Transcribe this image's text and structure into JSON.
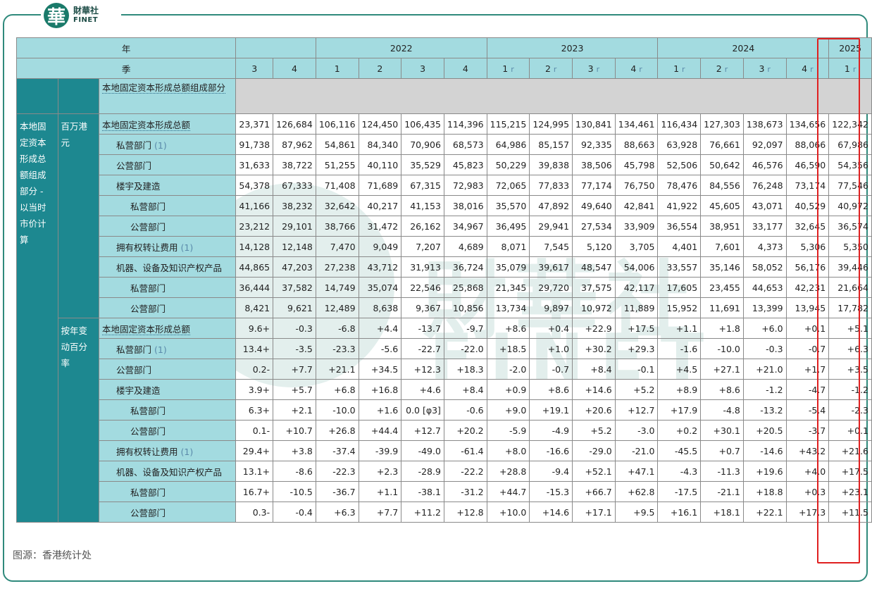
{
  "logo": {
    "cn": "財華社",
    "en": "FINET",
    "mark": "華"
  },
  "watermark": {
    "cn": "財華社",
    "en": "FINET"
  },
  "header": {
    "year_label": "年",
    "quarter_label": "季",
    "years": [
      "2022",
      "2023",
      "2024",
      "2025"
    ],
    "quarters": [
      "3",
      "4",
      "1",
      "2",
      "3",
      "4",
      "1",
      "2",
      "3",
      "4",
      "1",
      "2",
      "3",
      "4",
      "1"
    ],
    "r_flags": [
      false,
      false,
      false,
      false,
      false,
      false,
      true,
      true,
      true,
      true,
      true,
      true,
      true,
      true,
      true
    ],
    "r_symbol": "r"
  },
  "section_label": "本地固定资本形成总额组成部分",
  "left_group": "本地固定资本形成总额组成部分 - 以当时市价计算",
  "unit_groups": [
    "百万港元",
    "按年变动百分率"
  ],
  "rows_a": [
    {
      "label": "本地固定资本形成总额",
      "note": "",
      "level": 1,
      "values": [
        "23,371",
        "126,684",
        "106,116",
        "124,450",
        "106,435",
        "114,396",
        "115,215",
        "124,995",
        "130,841",
        "134,461",
        "116,434",
        "127,303",
        "138,673",
        "134,656",
        "122,342"
      ]
    },
    {
      "label": "私营部门",
      "note": "(1)",
      "level": 2,
      "values": [
        "91,738",
        "87,962",
        "54,861",
        "84,340",
        "70,906",
        "68,573",
        "64,986",
        "85,157",
        "92,335",
        "88,663",
        "63,928",
        "76,661",
        "92,097",
        "88,066",
        "67,986"
      ]
    },
    {
      "label": "公营部门",
      "note": "",
      "level": 2,
      "values": [
        "31,633",
        "38,722",
        "51,255",
        "40,110",
        "35,529",
        "45,823",
        "50,229",
        "39,838",
        "38,506",
        "45,798",
        "52,506",
        "50,642",
        "46,576",
        "46,590",
        "54,356"
      ]
    },
    {
      "label": "楼宇及建造",
      "note": "",
      "level": 2,
      "values": [
        "54,378",
        "67,333",
        "71,408",
        "71,689",
        "67,315",
        "72,983",
        "72,065",
        "77,833",
        "77,174",
        "76,750",
        "78,476",
        "84,556",
        "76,248",
        "73,174",
        "77,546"
      ]
    },
    {
      "label": "私营部门",
      "note": "",
      "level": 3,
      "values": [
        "41,166",
        "38,232",
        "32,642",
        "40,217",
        "41,153",
        "38,016",
        "35,570",
        "47,892",
        "49,640",
        "42,841",
        "41,922",
        "45,605",
        "43,071",
        "40,529",
        "40,972"
      ]
    },
    {
      "label": "公营部门",
      "note": "",
      "level": 3,
      "values": [
        "23,212",
        "29,101",
        "38,766",
        "31,472",
        "26,162",
        "34,967",
        "36,495",
        "29,941",
        "27,534",
        "33,909",
        "36,554",
        "38,951",
        "33,177",
        "32,645",
        "36,574"
      ]
    },
    {
      "label": "拥有权转让费用",
      "note": "(1)",
      "level": 2,
      "values": [
        "14,128",
        "12,148",
        "7,470",
        "9,049",
        "7,207",
        "4,689",
        "8,071",
        "7,545",
        "5,120",
        "3,705",
        "4,401",
        "7,601",
        "4,373",
        "5,306",
        "5,350"
      ]
    },
    {
      "label": "机器、设备及知识产权产品",
      "note": "",
      "level": 2,
      "values": [
        "44,865",
        "47,203",
        "27,238",
        "43,712",
        "31,913",
        "36,724",
        "35,079",
        "39,617",
        "48,547",
        "54,006",
        "33,557",
        "35,146",
        "58,052",
        "56,176",
        "39,446"
      ]
    },
    {
      "label": "私营部门",
      "note": "",
      "level": 3,
      "values": [
        "36,444",
        "37,582",
        "14,749",
        "35,074",
        "22,546",
        "25,868",
        "21,345",
        "29,720",
        "37,575",
        "42,117",
        "17,605",
        "23,455",
        "44,653",
        "42,231",
        "21,664"
      ]
    },
    {
      "label": "公营部门",
      "note": "",
      "level": 3,
      "values": [
        "8,421",
        "9,621",
        "12,489",
        "8,638",
        "9,367",
        "10,856",
        "13,734",
        "9,897",
        "10,972",
        "11,889",
        "15,952",
        "11,691",
        "13,399",
        "13,945",
        "17,782"
      ]
    }
  ],
  "rows_b": [
    {
      "label": "本地固定资本形成总额",
      "note": "",
      "level": 1,
      "values": [
        "+9.6",
        "-0.3",
        "-6.8",
        "+4.4",
        "-13.7",
        "-9.7",
        "+8.6",
        "+0.4",
        "+22.9",
        "+17.5",
        "+1.1",
        "+1.8",
        "+6.0",
        "+0.1",
        "+5.1"
      ]
    },
    {
      "label": "私营部门",
      "note": "(1)",
      "level": 2,
      "values": [
        "+13.4",
        "-3.5",
        "-23.3",
        "-5.6",
        "-22.7",
        "-22.0",
        "+18.5",
        "+1.0",
        "+30.2",
        "+29.3",
        "-1.6",
        "-10.0",
        "-0.3",
        "-0.7",
        "+6.3"
      ]
    },
    {
      "label": "公营部门",
      "note": "",
      "level": 2,
      "values": [
        "-0.2",
        "+7.7",
        "+21.1",
        "+34.5",
        "+12.3",
        "+18.3",
        "-2.0",
        "-0.7",
        "+8.4",
        "-0.1",
        "+4.5",
        "+27.1",
        "+21.0",
        "+1.7",
        "+3.5"
      ]
    },
    {
      "label": "楼宇及建造",
      "note": "",
      "level": 2,
      "values": [
        "+3.9",
        "+5.7",
        "+6.8",
        "+16.8",
        "+4.6",
        "+8.4",
        "+0.9",
        "+8.6",
        "+14.6",
        "+5.2",
        "+8.9",
        "+8.6",
        "-1.2",
        "-4.7",
        "-1.2"
      ]
    },
    {
      "label": "私营部门",
      "note": "",
      "level": 3,
      "values": [
        "+6.3",
        "+2.1",
        "-10.0",
        "+1.6",
        "0.0 [φ3]",
        "-0.6",
        "+9.0",
        "+19.1",
        "+20.6",
        "+12.7",
        "+17.9",
        "-4.8",
        "-13.2",
        "-5.4",
        "-2.3"
      ]
    },
    {
      "label": "公营部门",
      "note": "",
      "level": 3,
      "values": [
        "-0.1",
        "+10.7",
        "+26.8",
        "+44.4",
        "+12.7",
        "+20.2",
        "-5.9",
        "-4.9",
        "+5.2",
        "-3.0",
        "+0.2",
        "+30.1",
        "+20.5",
        "-3.7",
        "+0.1"
      ]
    },
    {
      "label": "拥有权转让费用",
      "note": "(1)",
      "level": 2,
      "values": [
        "+29.4",
        "+3.8",
        "-37.4",
        "-39.9",
        "-49.0",
        "-61.4",
        "+8.0",
        "-16.6",
        "-29.0",
        "-21.0",
        "-45.5",
        "+0.7",
        "-14.6",
        "+43.2",
        "+21.6"
      ]
    },
    {
      "label": "机器、设备及知识产权产品",
      "note": "",
      "level": 2,
      "values": [
        "+13.1",
        "-8.6",
        "-22.3",
        "+2.3",
        "-28.9",
        "-22.2",
        "+28.8",
        "-9.4",
        "+52.1",
        "+47.1",
        "-4.3",
        "-11.3",
        "+19.6",
        "+4.0",
        "+17.5"
      ]
    },
    {
      "label": "私营部门",
      "note": "",
      "level": 3,
      "values": [
        "+16.7",
        "-10.5",
        "-36.7",
        "+1.1",
        "-38.1",
        "-31.2",
        "+44.7",
        "-15.3",
        "+66.7",
        "+62.8",
        "-17.5",
        "-21.1",
        "+18.8",
        "+0.3",
        "+23.1"
      ]
    },
    {
      "label": "公营部门",
      "note": "",
      "level": 3,
      "values": [
        "-0.3",
        "-0.4",
        "+6.3",
        "+7.7",
        "+11.2",
        "+12.8",
        "+10.0",
        "+14.6",
        "+17.1",
        "+9.5",
        "+16.1",
        "+18.1",
        "+22.1",
        "+17.3",
        "+11.5"
      ]
    }
  ],
  "source": "图源：香港统计处",
  "colors": {
    "header_bg": "#a3dbe0",
    "group_bg": "#1d8890",
    "frame": "#2f8a7c",
    "highlight": "#e02020",
    "gray": "#d3d3d3"
  }
}
